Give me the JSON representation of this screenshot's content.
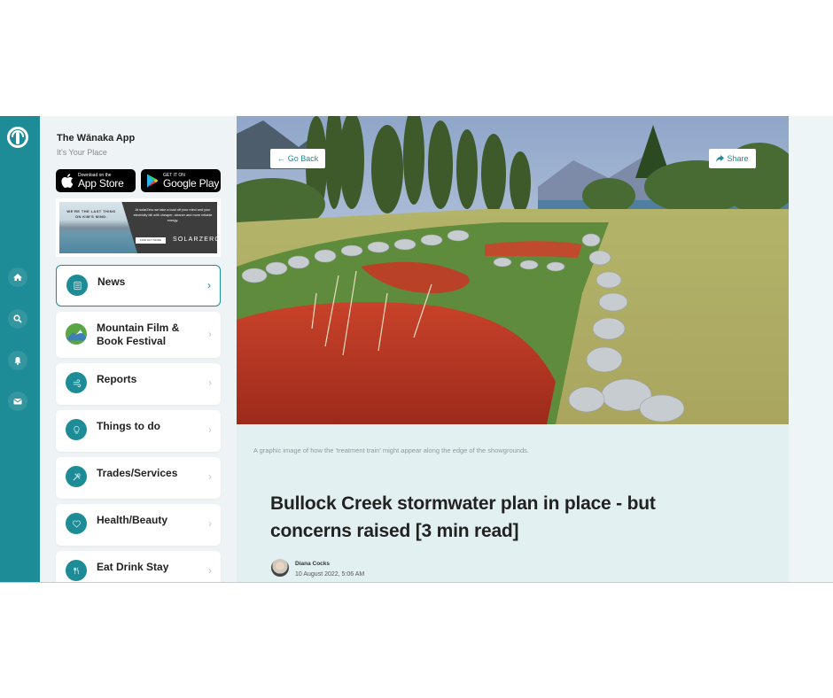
{
  "app": {
    "title": "The Wānaka App",
    "subtitle": "It's Your Place"
  },
  "store_buttons": {
    "apple": {
      "small": "Download on the",
      "large": "App Store"
    },
    "google": {
      "small": "GET IT ON",
      "large": "Google Play"
    }
  },
  "ad": {
    "headline": "WE'RE THE LAST THING ON KIM'S MIND.",
    "body": "At solarZero we take a load off your mind and your electricity bill with cheaper, cleaner and more reliable energy.",
    "cta": "FIND OUT MORE",
    "brand": "SOLARZERO"
  },
  "rail": {
    "items": [
      {
        "icon": "home-icon"
      },
      {
        "icon": "search-icon"
      },
      {
        "icon": "bell-icon"
      },
      {
        "icon": "mail-icon"
      }
    ]
  },
  "sidebar": {
    "items": [
      {
        "label": "News",
        "icon": "newspaper-icon",
        "active": true
      },
      {
        "label": "Mountain Film & Book Festival",
        "icon": "mountain-icon",
        "active": false
      },
      {
        "label": "Reports",
        "icon": "wind-icon",
        "active": false
      },
      {
        "label": "Things to do",
        "icon": "lightbulb-icon",
        "active": false
      },
      {
        "label": "Trades/Services",
        "icon": "tools-icon",
        "active": false
      },
      {
        "label": "Health/Beauty",
        "icon": "heart-icon",
        "active": false
      },
      {
        "label": "Eat Drink Stay",
        "icon": "cutlery-icon",
        "active": false
      }
    ],
    "chevron": "›"
  },
  "article": {
    "go_back_label": "Go Back",
    "share_label": "Share",
    "caption": "A graphic image of how the 'treatment train' might appear along the edge of the showgrounds.",
    "title": "Bullock Creek stormwater plan in place - but concerns raised [3 min read]",
    "author": "Diana Cocks",
    "date": "10 August 2022, 5:06 AM"
  },
  "colors": {
    "accent": "#1d8c96",
    "festival_green": "#5aa544"
  }
}
